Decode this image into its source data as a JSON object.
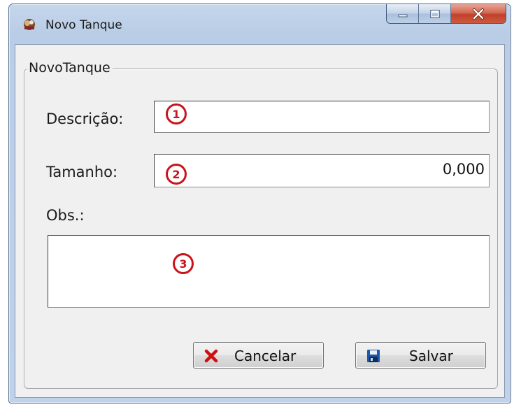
{
  "window": {
    "title": "Novo Tanque",
    "caption": {
      "minimize": "minimize-icon",
      "maximize": "maximize-icon",
      "close": "close-icon"
    }
  },
  "form": {
    "group_title": "NovoTanque",
    "descricao": {
      "label": "Descrição:",
      "value": "",
      "marker": "1"
    },
    "tamanho": {
      "label": "Tamanho:",
      "value": "0,000",
      "marker": "2"
    },
    "obs": {
      "label": "Obs.:",
      "value": "",
      "marker": "3"
    }
  },
  "buttons": {
    "cancel": {
      "label": "Cancelar",
      "icon": "x-icon"
    },
    "save": {
      "label": "Salvar",
      "icon": "floppy-disk-icon"
    }
  },
  "colors": {
    "marker": "#c8141b",
    "cancel_icon": "#d01010",
    "save_icon": "#1f57a8"
  }
}
